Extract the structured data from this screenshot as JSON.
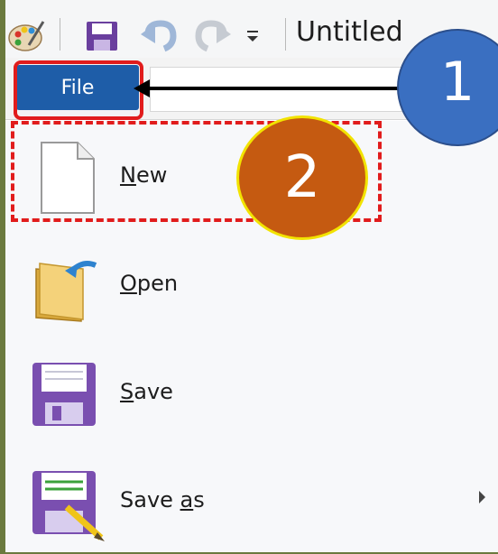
{
  "window": {
    "title": "Untitled -"
  },
  "toolbar": {
    "icons": [
      "paint-palette-icon",
      "save-icon",
      "undo-icon",
      "redo-icon",
      "customize-dropdown-icon"
    ]
  },
  "ribbon": {
    "file_tab_label": "File"
  },
  "menu": {
    "items": [
      {
        "prefix": "",
        "underline": "N",
        "suffix": "ew",
        "icon": "new-document-icon"
      },
      {
        "prefix": "",
        "underline": "O",
        "suffix": "pen",
        "icon": "open-folder-icon"
      },
      {
        "prefix": "",
        "underline": "S",
        "suffix": "ave",
        "icon": "save-disk-icon"
      },
      {
        "prefix": "Save ",
        "underline": "a",
        "suffix": "s",
        "icon": "save-as-icon",
        "has_submenu": true
      }
    ]
  },
  "annotations": {
    "step1": "1",
    "step2": "2"
  },
  "colors": {
    "file_tab": "#1e5da8",
    "highlight_red": "#e11c1c",
    "step1_circle": "#3a6fc1",
    "step2_circle": "#c55a11",
    "frame_bg": "#6b7a3e"
  }
}
